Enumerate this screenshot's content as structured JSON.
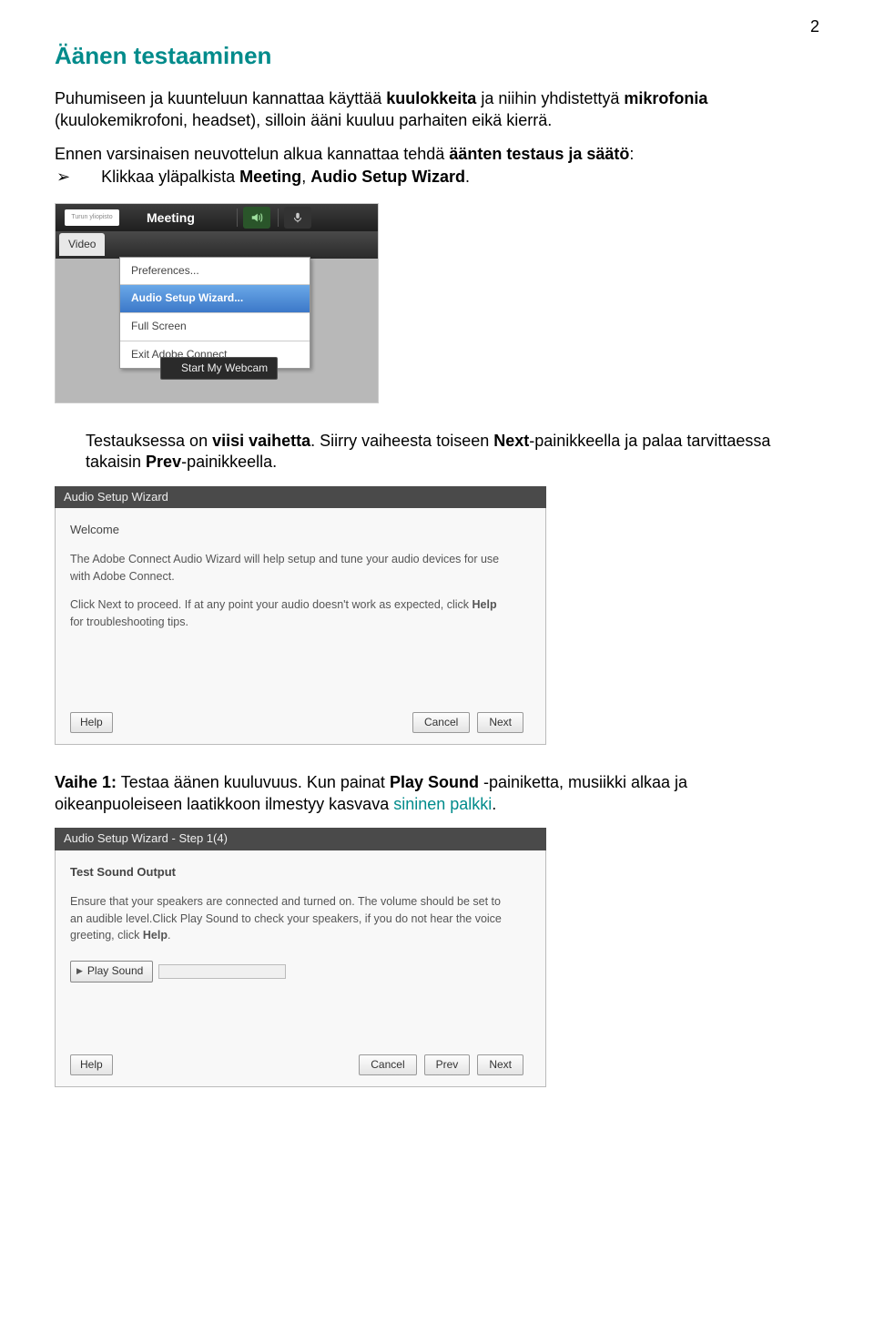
{
  "page_number": "2",
  "title": "Äänen testaaminen",
  "intro_parts": {
    "t1": "Puhumiseen ja kuunteluun kannattaa käyttää ",
    "b1": "kuulokkeita",
    "t2": " ja niihin yhdistettyä ",
    "b2": "mikrofonia",
    "t3": " (kuulokemikrofoni, headset), silloin ääni kuuluu parhaiten eikä kierrä."
  },
  "pretest_parts": {
    "t1": "Ennen varsinaisen neuvottelun alkua kannattaa tehdä ",
    "b1": "äänten testaus ja säätö",
    "t2": ":"
  },
  "bullet_parts": {
    "t1": "Klikkaa yläpalkista ",
    "b1": "Meeting",
    "t2": ", ",
    "b2": "Audio Setup Wizard",
    "t3": "."
  },
  "shot1": {
    "logo_text": "Turun yliopisto",
    "meeting_label": "Meeting",
    "video_tab": "Video",
    "menu": {
      "preferences": "Preferences...",
      "audio_setup": "Audio Setup Wizard...",
      "full_screen": "Full Screen",
      "exit": "Exit Adobe Connect"
    },
    "webcam_btn": "Start My Webcam"
  },
  "mid_parts": {
    "t1": "Testauksessa on ",
    "b1": "viisi vaihetta",
    "t2": ". Siirry vaiheesta toiseen ",
    "b2": "Next",
    "t3": "-painikkeella ja palaa tarvittaessa takaisin ",
    "b3": "Prev",
    "t4": "-painikkeella."
  },
  "shot2a": {
    "title": "Audio Setup Wizard",
    "welcome": "Welcome",
    "p1": "The Adobe Connect Audio Wizard will help setup and tune your audio devices for use with Adobe Connect.",
    "p2a": "Click Next to proceed. If at any point your audio doesn't work as expected, click ",
    "p2b": "Help",
    "p2c": " for troubleshooting tips.",
    "help": "Help",
    "cancel": "Cancel",
    "next": "Next"
  },
  "vaihe1_parts": {
    "b1": "Vaihe 1:",
    "t1": " Testaa äänen kuuluvuus. Kun painat ",
    "b2": "Play Sound",
    "t2": " -painiketta, musiikki alkaa ja oikeanpuoleiseen laatikkoon ilmestyy kasvava ",
    "s1": "sininen palkki",
    "t3": "."
  },
  "shot2b": {
    "title": "Audio Setup Wizard - Step 1(4)",
    "heading": "Test Sound Output",
    "p1a": "Ensure that your speakers are connected and turned on. The volume should be set to an audible level.Click Play Sound to check your speakers, if you do not hear the voice greeting, click ",
    "p1b": "Help",
    "p1c": ".",
    "play": "Play Sound",
    "help": "Help",
    "cancel": "Cancel",
    "prev": "Prev",
    "next": "Next"
  }
}
